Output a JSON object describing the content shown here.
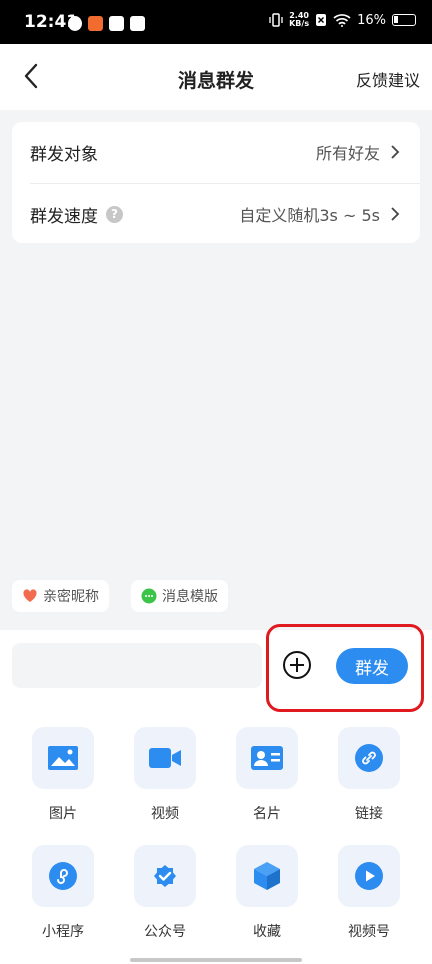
{
  "status_bar": {
    "time": "12:41",
    "net_speed_value": "2.40",
    "net_speed_unit": "KB/s",
    "battery": "16%"
  },
  "nav": {
    "title": "消息群发",
    "right_action": "反馈建议"
  },
  "settings": [
    {
      "label": "群发对象",
      "value": "所有好友"
    },
    {
      "label": "群发速度",
      "value": "自定义随机3s ~ 5s",
      "help": "?"
    }
  ],
  "chips": [
    {
      "label": "亲密昵称",
      "icon": "heart-icon",
      "color": "#f26b4f"
    },
    {
      "label": "消息模版",
      "icon": "chat-bubble-icon",
      "color": "#3cc44a"
    }
  ],
  "composer": {
    "input_value": "",
    "send_label": "群发"
  },
  "tools": [
    {
      "label": "图片",
      "icon": "image-icon"
    },
    {
      "label": "视频",
      "icon": "video-camera-icon"
    },
    {
      "label": "名片",
      "icon": "contact-card-icon"
    },
    {
      "label": "链接",
      "icon": "link-icon"
    },
    {
      "label": "小程序",
      "icon": "mini-program-icon"
    },
    {
      "label": "公众号",
      "icon": "official-account-icon"
    },
    {
      "label": "收藏",
      "icon": "favorites-box-icon"
    },
    {
      "label": "视频号",
      "icon": "channels-play-icon"
    }
  ],
  "colors": {
    "accent": "#2d8cf0",
    "highlight": "#e0191f"
  }
}
